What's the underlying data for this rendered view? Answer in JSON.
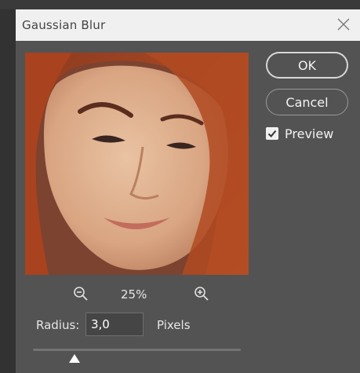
{
  "dialog": {
    "title": "Gaussian Blur",
    "close_icon": "close-icon"
  },
  "buttons": {
    "ok_label": "OK",
    "cancel_label": "Cancel"
  },
  "preview": {
    "label": "Preview",
    "checked": true,
    "image_description": "portrait-photo"
  },
  "zoom": {
    "level": "25%",
    "zoom_out_icon": "zoom-out-icon",
    "zoom_in_icon": "zoom-in-icon"
  },
  "radius": {
    "label": "Radius:",
    "value": "3,0",
    "units": "Pixels",
    "slider_fraction": 0.2
  },
  "colors": {
    "dialog_bg": "#535353",
    "titlebar_bg": "#f0f0f0",
    "text": "#e6e6e6"
  }
}
